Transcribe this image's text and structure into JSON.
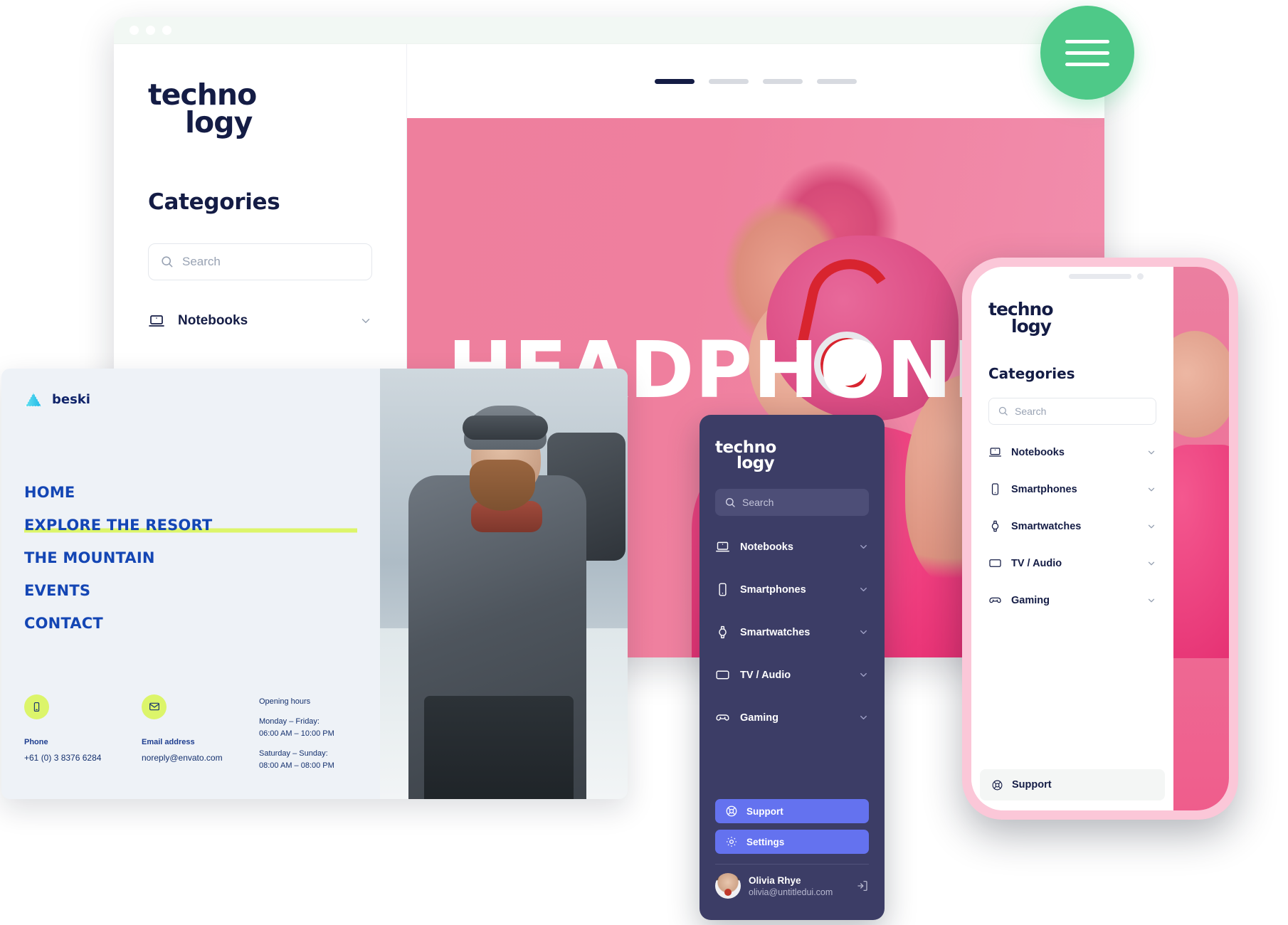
{
  "desktop": {
    "window_dots": [
      "close",
      "minimize",
      "maximize"
    ],
    "logo": {
      "line1": "techno",
      "line2": "logy"
    },
    "categories_title": "Categories",
    "search": {
      "placeholder": "Search",
      "icon": "search-icon"
    },
    "category": {
      "label": "Notebooks",
      "icon": "laptop-icon",
      "chevron": "chevron-down-icon"
    },
    "carousel": {
      "count": 4,
      "active_index": 0
    },
    "hero_title": "HEADPHONES"
  },
  "fab": {
    "icon": "hamburger-menu-icon",
    "color": "#4ec988"
  },
  "beski": {
    "logo": {
      "name": "beski",
      "icon": "mountain-icon"
    },
    "nav": [
      {
        "label": "HOME",
        "highlighted": false
      },
      {
        "label": "EXPLORE THE RESORT",
        "highlighted": true
      },
      {
        "label": "THE MOUNTAIN",
        "highlighted": false
      },
      {
        "label": "EVENTS",
        "highlighted": false
      },
      {
        "label": "CONTACT",
        "highlighted": false
      }
    ],
    "contact": {
      "phone": {
        "icon": "phone-icon",
        "label": "Phone",
        "value": "+61 (0) 3 8376 6284"
      },
      "email": {
        "icon": "envelope-icon",
        "label": "Email address",
        "value": "noreply@envato.com"
      }
    },
    "hours": {
      "title": "Opening hours",
      "weekday_days": "Monday – Friday:",
      "weekday_time": "06:00 AM – 10:00 PM",
      "weekend_days": "Saturday – Sunday:",
      "weekend_time": "08:00 AM – 08:00 PM"
    },
    "highlight_color": "#dcf56a",
    "link_color": "#1446b4"
  },
  "dark_panel": {
    "background": "#3c3d66",
    "logo": {
      "line1": "techno",
      "line2": "logy"
    },
    "search": {
      "placeholder": "Search",
      "icon": "search-icon"
    },
    "items": [
      {
        "label": "Notebooks",
        "icon": "laptop-icon"
      },
      {
        "label": "Smartphones",
        "icon": "smartphone-icon"
      },
      {
        "label": "Smartwatches",
        "icon": "smartwatch-icon"
      },
      {
        "label": "TV / Audio",
        "icon": "tv-icon"
      },
      {
        "label": "Gaming",
        "icon": "gamepad-icon"
      }
    ],
    "buttons": [
      {
        "label": "Support",
        "icon": "lifebuoy-icon"
      },
      {
        "label": "Settings",
        "icon": "gear-icon"
      }
    ],
    "button_color": "#6472ef",
    "user": {
      "name": "Olivia Rhye",
      "email": "olivia@untitledui.com",
      "logout_icon": "logout-icon",
      "avatar": "avatar"
    }
  },
  "phone": {
    "frame_color": "#fbc7d8",
    "logo": {
      "line1": "techno",
      "line2": "logy"
    },
    "categories_title": "Categories",
    "search": {
      "placeholder": "Search",
      "icon": "search-icon"
    },
    "items": [
      {
        "label": "Notebooks",
        "icon": "laptop-icon"
      },
      {
        "label": "Smartphones",
        "icon": "smartphone-icon"
      },
      {
        "label": "Smartwatches",
        "icon": "smartwatch-icon"
      },
      {
        "label": "TV / Audio",
        "icon": "tv-icon"
      },
      {
        "label": "Gaming",
        "icon": "gamepad-icon"
      }
    ],
    "support": {
      "label": "Support",
      "icon": "lifebuoy-icon"
    }
  }
}
